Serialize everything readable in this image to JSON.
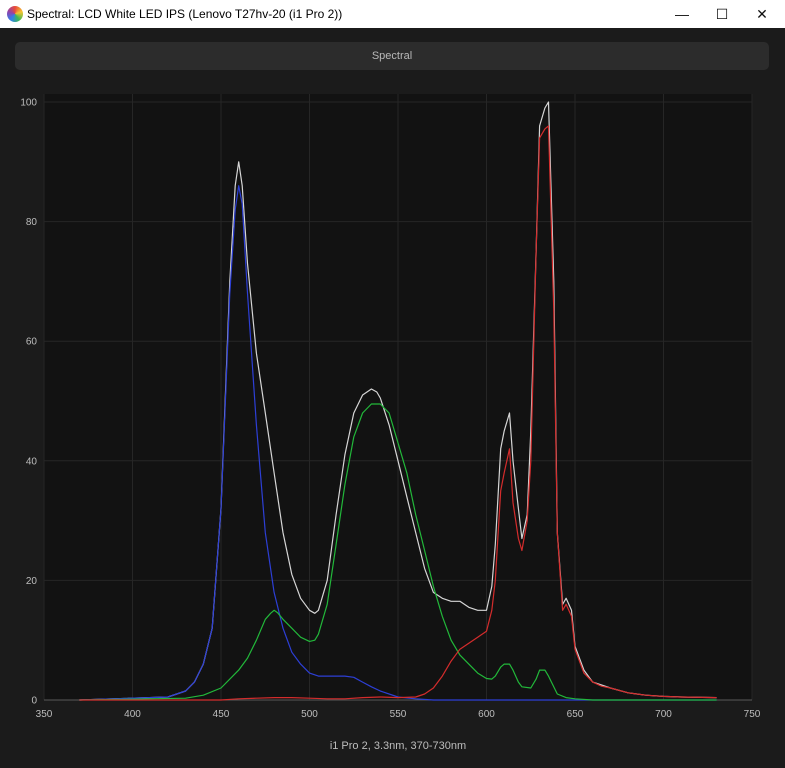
{
  "window": {
    "title": "Spectral: LCD White LED IPS (Lenovo T27hv-20 (i1 Pro 2))",
    "minimize_glyph": "—",
    "maximize_glyph": "☐",
    "close_glyph": "✕"
  },
  "header": {
    "label": "Spectral"
  },
  "chart_data": {
    "type": "line",
    "title": "",
    "xlabel": "i1 Pro 2, 3.3nm, 370-730nm",
    "ylabel": "",
    "xlim": [
      350,
      750
    ],
    "ylim": [
      0,
      100
    ],
    "xticks": [
      350,
      400,
      450,
      500,
      550,
      600,
      650,
      700,
      750
    ],
    "yticks": [
      0,
      20,
      40,
      60,
      80,
      100
    ],
    "grid": true,
    "legend": "none",
    "series": [
      {
        "color": "#d6d6d6",
        "x": [
          370,
          420,
          430,
          435,
          440,
          445,
          450,
          455,
          458,
          460,
          462,
          465,
          470,
          475,
          480,
          485,
          490,
          495,
          500,
          503,
          505,
          510,
          515,
          520,
          525,
          530,
          535,
          538,
          540,
          545,
          550,
          555,
          560,
          565,
          570,
          575,
          580,
          585,
          590,
          595,
          600,
          603,
          605,
          608,
          610,
          613,
          615,
          618,
          620,
          623,
          625,
          628,
          630,
          633,
          635,
          638,
          640,
          643,
          645,
          648,
          650,
          655,
          660,
          665,
          670,
          680,
          690,
          700,
          710,
          730
        ],
        "y": [
          0,
          0.5,
          1.5,
          3,
          6,
          12,
          32,
          70,
          86,
          90,
          86,
          73,
          58,
          48,
          38,
          28,
          21,
          17,
          15,
          14.5,
          15,
          20,
          31,
          41,
          48,
          51,
          52,
          51.5,
          50.5,
          46,
          40,
          34,
          28,
          22,
          18,
          17,
          16.5,
          16.5,
          15.5,
          15,
          15,
          19,
          26,
          42,
          45,
          48,
          40,
          32,
          27,
          31,
          45,
          75,
          96,
          99,
          100,
          70,
          28,
          16,
          17,
          15,
          9,
          5,
          3,
          2.5,
          2,
          1.2,
          0.8,
          0.6,
          0.5,
          0.4
        ]
      },
      {
        "color": "#2d3fd6",
        "x": [
          370,
          420,
          430,
          435,
          440,
          445,
          450,
          455,
          458,
          460,
          462,
          465,
          470,
          475,
          480,
          485,
          490,
          495,
          500,
          505,
          510,
          520,
          525,
          530,
          535,
          540,
          550,
          560,
          570,
          580,
          600,
          650,
          730
        ],
        "y": [
          0,
          0.5,
          1.5,
          3,
          6,
          12,
          32,
          68,
          82,
          86,
          83,
          68,
          46,
          28,
          18,
          12,
          8,
          6,
          4.5,
          4,
          4,
          4,
          3.8,
          3,
          2.2,
          1.5,
          0.5,
          0.2,
          0,
          0,
          0,
          0,
          0
        ]
      },
      {
        "color": "#22b83a",
        "x": [
          370,
          430,
          440,
          450,
          460,
          465,
          470,
          475,
          478,
          480,
          482,
          485,
          490,
          495,
          500,
          503,
          505,
          510,
          515,
          520,
          525,
          530,
          535,
          540,
          545,
          550,
          555,
          560,
          565,
          570,
          575,
          580,
          585,
          590,
          595,
          600,
          603,
          605,
          608,
          610,
          613,
          615,
          618,
          620,
          625,
          628,
          630,
          633,
          635,
          640,
          645,
          650,
          660,
          730
        ],
        "y": [
          0,
          0.3,
          0.8,
          2,
          5,
          7,
          10,
          13.5,
          14.5,
          15,
          14.6,
          13.5,
          12,
          10.5,
          9.8,
          10,
          11,
          16,
          26,
          36,
          44,
          48,
          49.5,
          49.5,
          48,
          43,
          38,
          31,
          25,
          19,
          14,
          10,
          7.5,
          6,
          4.5,
          3.6,
          3.5,
          4,
          5.5,
          6,
          6,
          5,
          3,
          2.2,
          2,
          3.5,
          5,
          5,
          4,
          1,
          0.4,
          0.2,
          0,
          0
        ]
      },
      {
        "color": "#d42c2c",
        "x": [
          370,
          450,
          460,
          470,
          480,
          490,
          500,
          510,
          520,
          530,
          540,
          550,
          560,
          565,
          570,
          575,
          580,
          585,
          590,
          595,
          600,
          603,
          605,
          608,
          610,
          613,
          615,
          618,
          620,
          623,
          625,
          628,
          630,
          633,
          635,
          638,
          640,
          643,
          645,
          648,
          650,
          655,
          660,
          665,
          670,
          680,
          690,
          700,
          710,
          730
        ],
        "y": [
          0,
          0,
          0.2,
          0.3,
          0.4,
          0.4,
          0.3,
          0.2,
          0.2,
          0.4,
          0.5,
          0.4,
          0.5,
          1,
          2,
          4,
          6.5,
          8.5,
          9.5,
          10.5,
          11.5,
          15,
          20,
          35,
          38,
          42,
          33,
          27,
          25,
          30,
          40,
          75,
          94,
          95.5,
          96,
          65,
          28,
          15,
          16,
          14,
          8.5,
          4.5,
          3,
          2.3,
          2,
          1.2,
          0.8,
          0.6,
          0.5,
          0.4
        ]
      }
    ]
  }
}
